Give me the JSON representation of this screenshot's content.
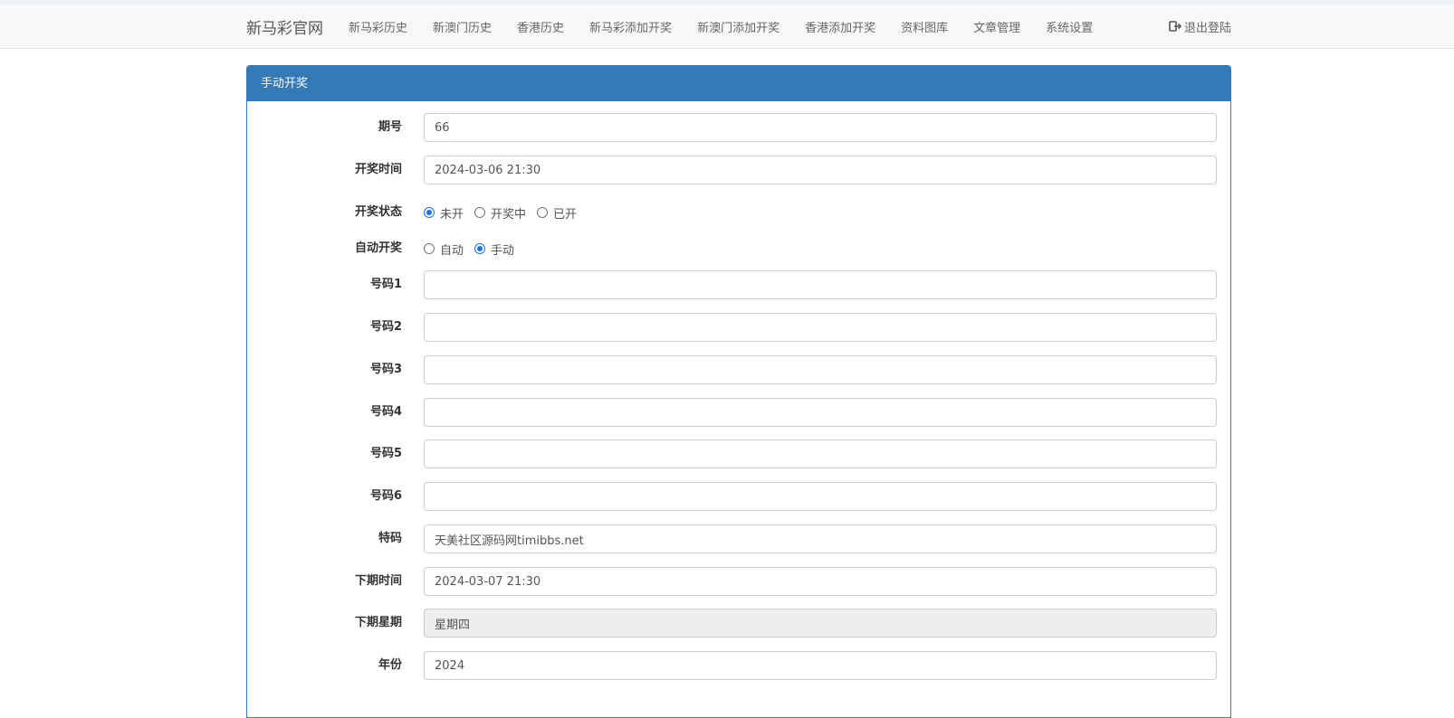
{
  "navbar": {
    "brand": "新马彩官网",
    "links": [
      "新马彩历史",
      "新澳门历史",
      "香港历史",
      "新马彩添加开奖",
      "新澳门添加开奖",
      "香港添加开奖",
      "资料图库",
      "文章管理",
      "系统设置"
    ],
    "logout_label": "退出登陆",
    "logout_icon": "logout-icon"
  },
  "panel": {
    "title": "手动开奖"
  },
  "form": {
    "issue": {
      "label": "期号",
      "value": "66"
    },
    "draw_time": {
      "label": "开奖时间",
      "value": "2024-03-06 21:30"
    },
    "draw_status": {
      "label": "开奖状态",
      "options": [
        "未开",
        "开奖中",
        "已开"
      ],
      "selected": "未开"
    },
    "auto_draw": {
      "label": "自动开奖",
      "options": [
        "自动",
        "手动"
      ],
      "selected": "手动"
    },
    "numbers": [
      {
        "label": "号码1",
        "value": ""
      },
      {
        "label": "号码2",
        "value": ""
      },
      {
        "label": "号码3",
        "value": ""
      },
      {
        "label": "号码4",
        "value": ""
      },
      {
        "label": "号码5",
        "value": ""
      },
      {
        "label": "号码6",
        "value": ""
      }
    ],
    "special": {
      "label": "特码",
      "value": "天美社区源码网timibbs.net"
    },
    "next_time": {
      "label": "下期时间",
      "value": "2024-03-07 21:30"
    },
    "next_weekday": {
      "label": "下期星期",
      "value": "星期四"
    },
    "year": {
      "label": "年份",
      "value": "2024"
    }
  },
  "colors": {
    "panel_primary": "#337ab7",
    "radio_checked": "#1a73e8"
  }
}
